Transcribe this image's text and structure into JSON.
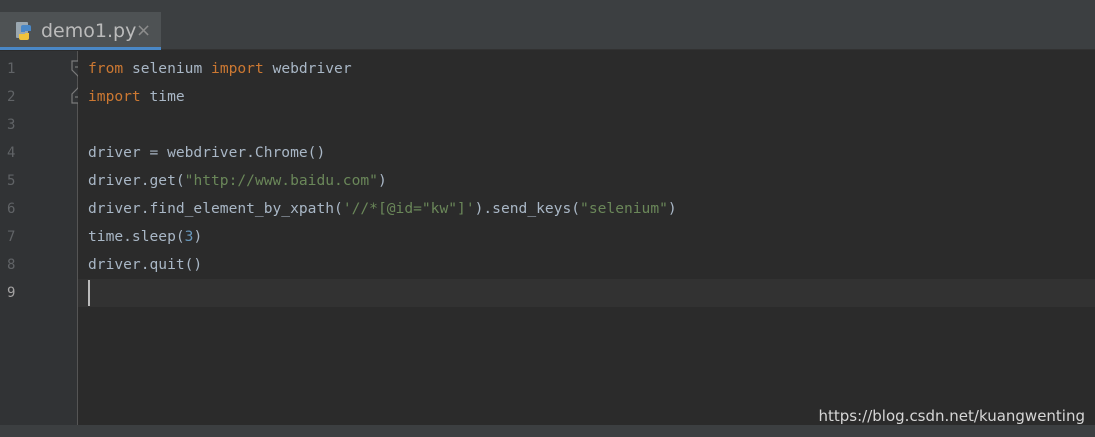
{
  "tab": {
    "title": "demo1.py",
    "close": "×",
    "icon": "python-file-icon"
  },
  "gutter": {
    "line_numbers": [
      "1",
      "2",
      "3",
      "4",
      "5",
      "6",
      "7",
      "8",
      "9"
    ],
    "current_line": "9"
  },
  "code": {
    "l1": {
      "kw1": "from",
      "t1": " selenium ",
      "kw2": "import",
      "t2": " webdriver"
    },
    "l2": {
      "kw1": "import",
      "t1": " time"
    },
    "l4": {
      "t1": "driver = webdriver.Chrome()"
    },
    "l5": {
      "t1": "driver.get(",
      "s1": "\"http://www.baidu.com\"",
      "t2": ")"
    },
    "l6": {
      "t1": "driver.find_element_by_xpath(",
      "s1": "'//*[@id=\"kw\"]'",
      "t2": ").send_keys(",
      "s2": "\"selenium\"",
      "t3": ")"
    },
    "l7": {
      "t1": "time.sleep(",
      "n1": "3",
      "t2": ")"
    },
    "l8": {
      "t1": "driver.quit()"
    }
  },
  "watermark": "https://blog.csdn.net/kuangwenting",
  "colors": {
    "keyword": "#cc7832",
    "string": "#6a8759",
    "number": "#6897bb",
    "text": "#a9b7c6",
    "tab_accent": "#4a88c7"
  }
}
